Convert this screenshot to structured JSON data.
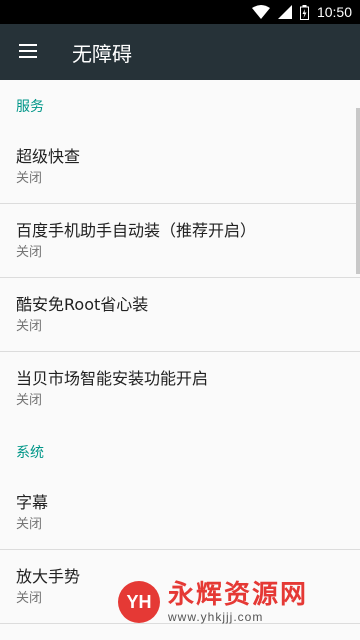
{
  "status_bar": {
    "time": "10:50",
    "icons": [
      "wifi-icon",
      "signal-icon",
      "battery-icon"
    ]
  },
  "app_bar": {
    "title": "无障碍",
    "menu_icon": "menu-icon"
  },
  "sections": [
    {
      "header": "服务",
      "items": [
        {
          "title": "超级快查",
          "summary": "关闭"
        },
        {
          "title": "百度手机助手自动装（推荐开启）",
          "summary": "关闭"
        },
        {
          "title": "酷安免Root省心装",
          "summary": "关闭"
        },
        {
          "title": "当贝市场智能安装功能开启",
          "summary": "关闭"
        }
      ]
    },
    {
      "header": "系统",
      "items": [
        {
          "title": "字幕",
          "summary": "关闭"
        },
        {
          "title": "放大手势",
          "summary": "关闭"
        }
      ]
    }
  ],
  "watermark": {
    "logo": "YH",
    "text": "永辉资源网",
    "url": "www.yhkjjj.com"
  },
  "colors": {
    "app_bar": "#263238",
    "accent": "#009688",
    "watermark": "#e53935"
  }
}
